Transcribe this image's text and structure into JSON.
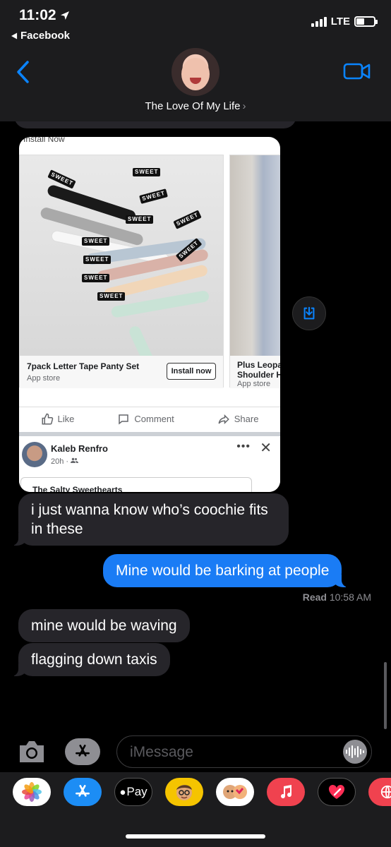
{
  "status_bar": {
    "time": "11:02",
    "back_app": "Facebook",
    "network": "LTE"
  },
  "conversation": {
    "contact_name": "The Love Of My Life"
  },
  "shared_post": {
    "top_text": "Install Now",
    "ads": [
      {
        "title": "7pack Letter Tape Panty Set",
        "subtitle": "App store",
        "button": "Install now"
      },
      {
        "title": "Plus Leopa Shoulder H",
        "subtitle": "App store"
      }
    ],
    "actions": {
      "like": "Like",
      "comment": "Comment",
      "share": "Share"
    },
    "post": {
      "author": "Kaleb Renfro",
      "time": "20h · ",
      "snippet": "The Salty Sweethearts"
    },
    "tape_text": "SWEET"
  },
  "messages": [
    {
      "direction": "incoming",
      "text": "i just wanna know who’s coochie fits in these"
    },
    {
      "direction": "outgoing",
      "text": "Mine would be barking at people"
    },
    {
      "direction": "incoming",
      "text": "mine would be waving"
    },
    {
      "direction": "incoming",
      "text": "flagging down taxis"
    }
  ],
  "read_receipt": {
    "label": "Read",
    "time": "10:58 AM"
  },
  "compose": {
    "placeholder": "iMessage"
  },
  "drawer": {
    "apple_pay_label": "Pay"
  },
  "colors": {
    "outgoing_bubble": "#1a7cf5",
    "incoming_bubble": "#26252a",
    "accent": "#0a84ff"
  }
}
